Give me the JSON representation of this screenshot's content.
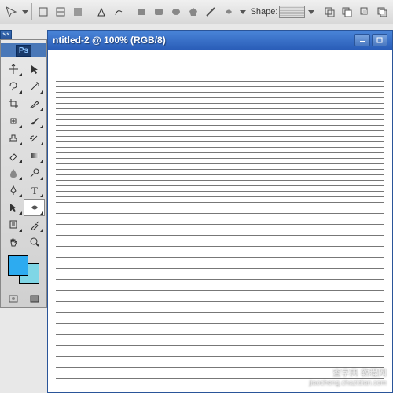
{
  "options_bar": {
    "shape_label": "Shape:"
  },
  "tools_panel": {
    "logo": "Ps"
  },
  "document": {
    "title": "ntitled-2 @  100% (RGB/8)"
  },
  "colors": {
    "foreground": "#2dabf0",
    "background": "#7fd6e6"
  },
  "watermark": {
    "text": "查字典 教程网",
    "url": "jiaocheng.chazidian.com"
  }
}
